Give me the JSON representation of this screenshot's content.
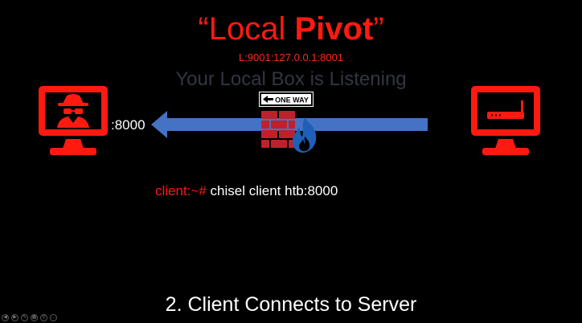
{
  "slide": {
    "title_plain": "“Local ",
    "title_bold": "Pivot",
    "title_close": "”",
    "subtitle": "L:9001:127.0.0.1:8001",
    "heading": "Your Local Box is Listening",
    "port_label": ":8000",
    "sign_text": "ONE WAY",
    "command_prompt": "client:~# ",
    "command_text": "chisel client htb:8000",
    "step_caption": "2. Client Connects to Server"
  },
  "icons": {
    "left_monitor": "hacker-monitor-icon",
    "right_monitor": "router-monitor-icon",
    "firewall": "firewall-icon",
    "arrow": "left-arrow-icon"
  },
  "presenter_controls": [
    {
      "name": "prev-slide-control",
      "glyph": "◀"
    },
    {
      "name": "next-slide-control",
      "glyph": "▶"
    },
    {
      "name": "pen-control",
      "glyph": "✎"
    },
    {
      "name": "slides-control",
      "glyph": "▦"
    },
    {
      "name": "zoom-control",
      "glyph": "⚲"
    },
    {
      "name": "more-control",
      "glyph": "…"
    }
  ],
  "colors": {
    "accent_red": "#ff1a10",
    "arrow_blue": "#4472c4",
    "flame_blue": "#1f5fb8",
    "background": "#000000"
  }
}
